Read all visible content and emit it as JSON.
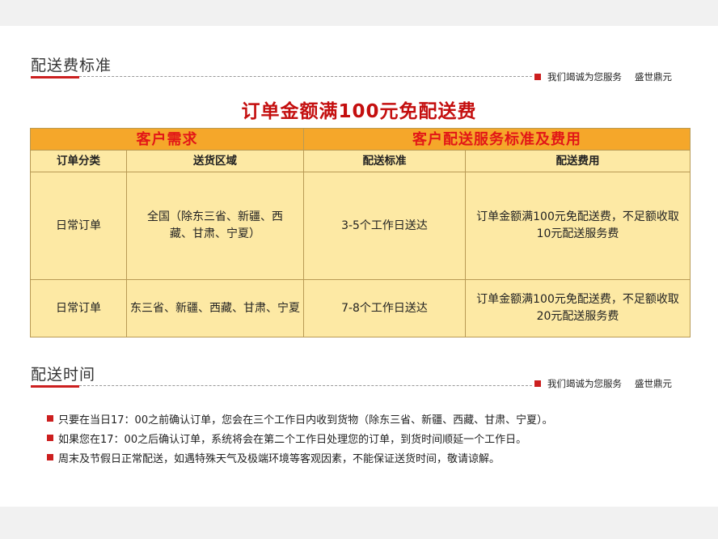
{
  "section1": {
    "title": "配送费标准",
    "slogan": "我们竭诚为您服务",
    "brand": "盛世鼎元"
  },
  "main_title": "订单金额满100元免配送费",
  "table": {
    "group_headers": [
      "客户需求",
      "客户配送服务标准及费用"
    ],
    "column_headers": [
      "订单分类",
      "送货区域",
      "配送标准",
      "配送费用"
    ],
    "rows": [
      {
        "category": "日常订单",
        "area": "全国（除东三省、新疆、西藏、甘肃、宁夏）",
        "standard": "3-5个工作日送达",
        "fee": "订单金额满100元免配送费，不足额收取10元配送服务费"
      },
      {
        "category": "日常订单",
        "area": "东三省、新疆、西藏、甘肃、宁夏",
        "standard": "7-8个工作日送达",
        "fee": "订单金额满100元免配送费，不足额收取20元配送服务费"
      }
    ]
  },
  "section2": {
    "title": "配送时间",
    "slogan": "我们竭诚为您服务",
    "brand": "盛世鼎元"
  },
  "notes": [
    "只要在当日17：00之前确认订单，您会在三个工作日内收到货物（除东三省、新疆、西藏、甘肃、宁夏）。",
    "如果您在17：00之后确认订单，系统将会在第二个工作日处理您的订单，到货时间顺延一个工作日。",
    "周末及节假日正常配送，如遇特殊天气及极端环境等客观因素，不能保证送货时间，敬请谅解。"
  ],
  "colors": {
    "accent_red": "#cc1f1f",
    "title_red": "#c40f0f",
    "header_orange": "#f5a72a",
    "cell_yellow": "#fde9a4"
  }
}
